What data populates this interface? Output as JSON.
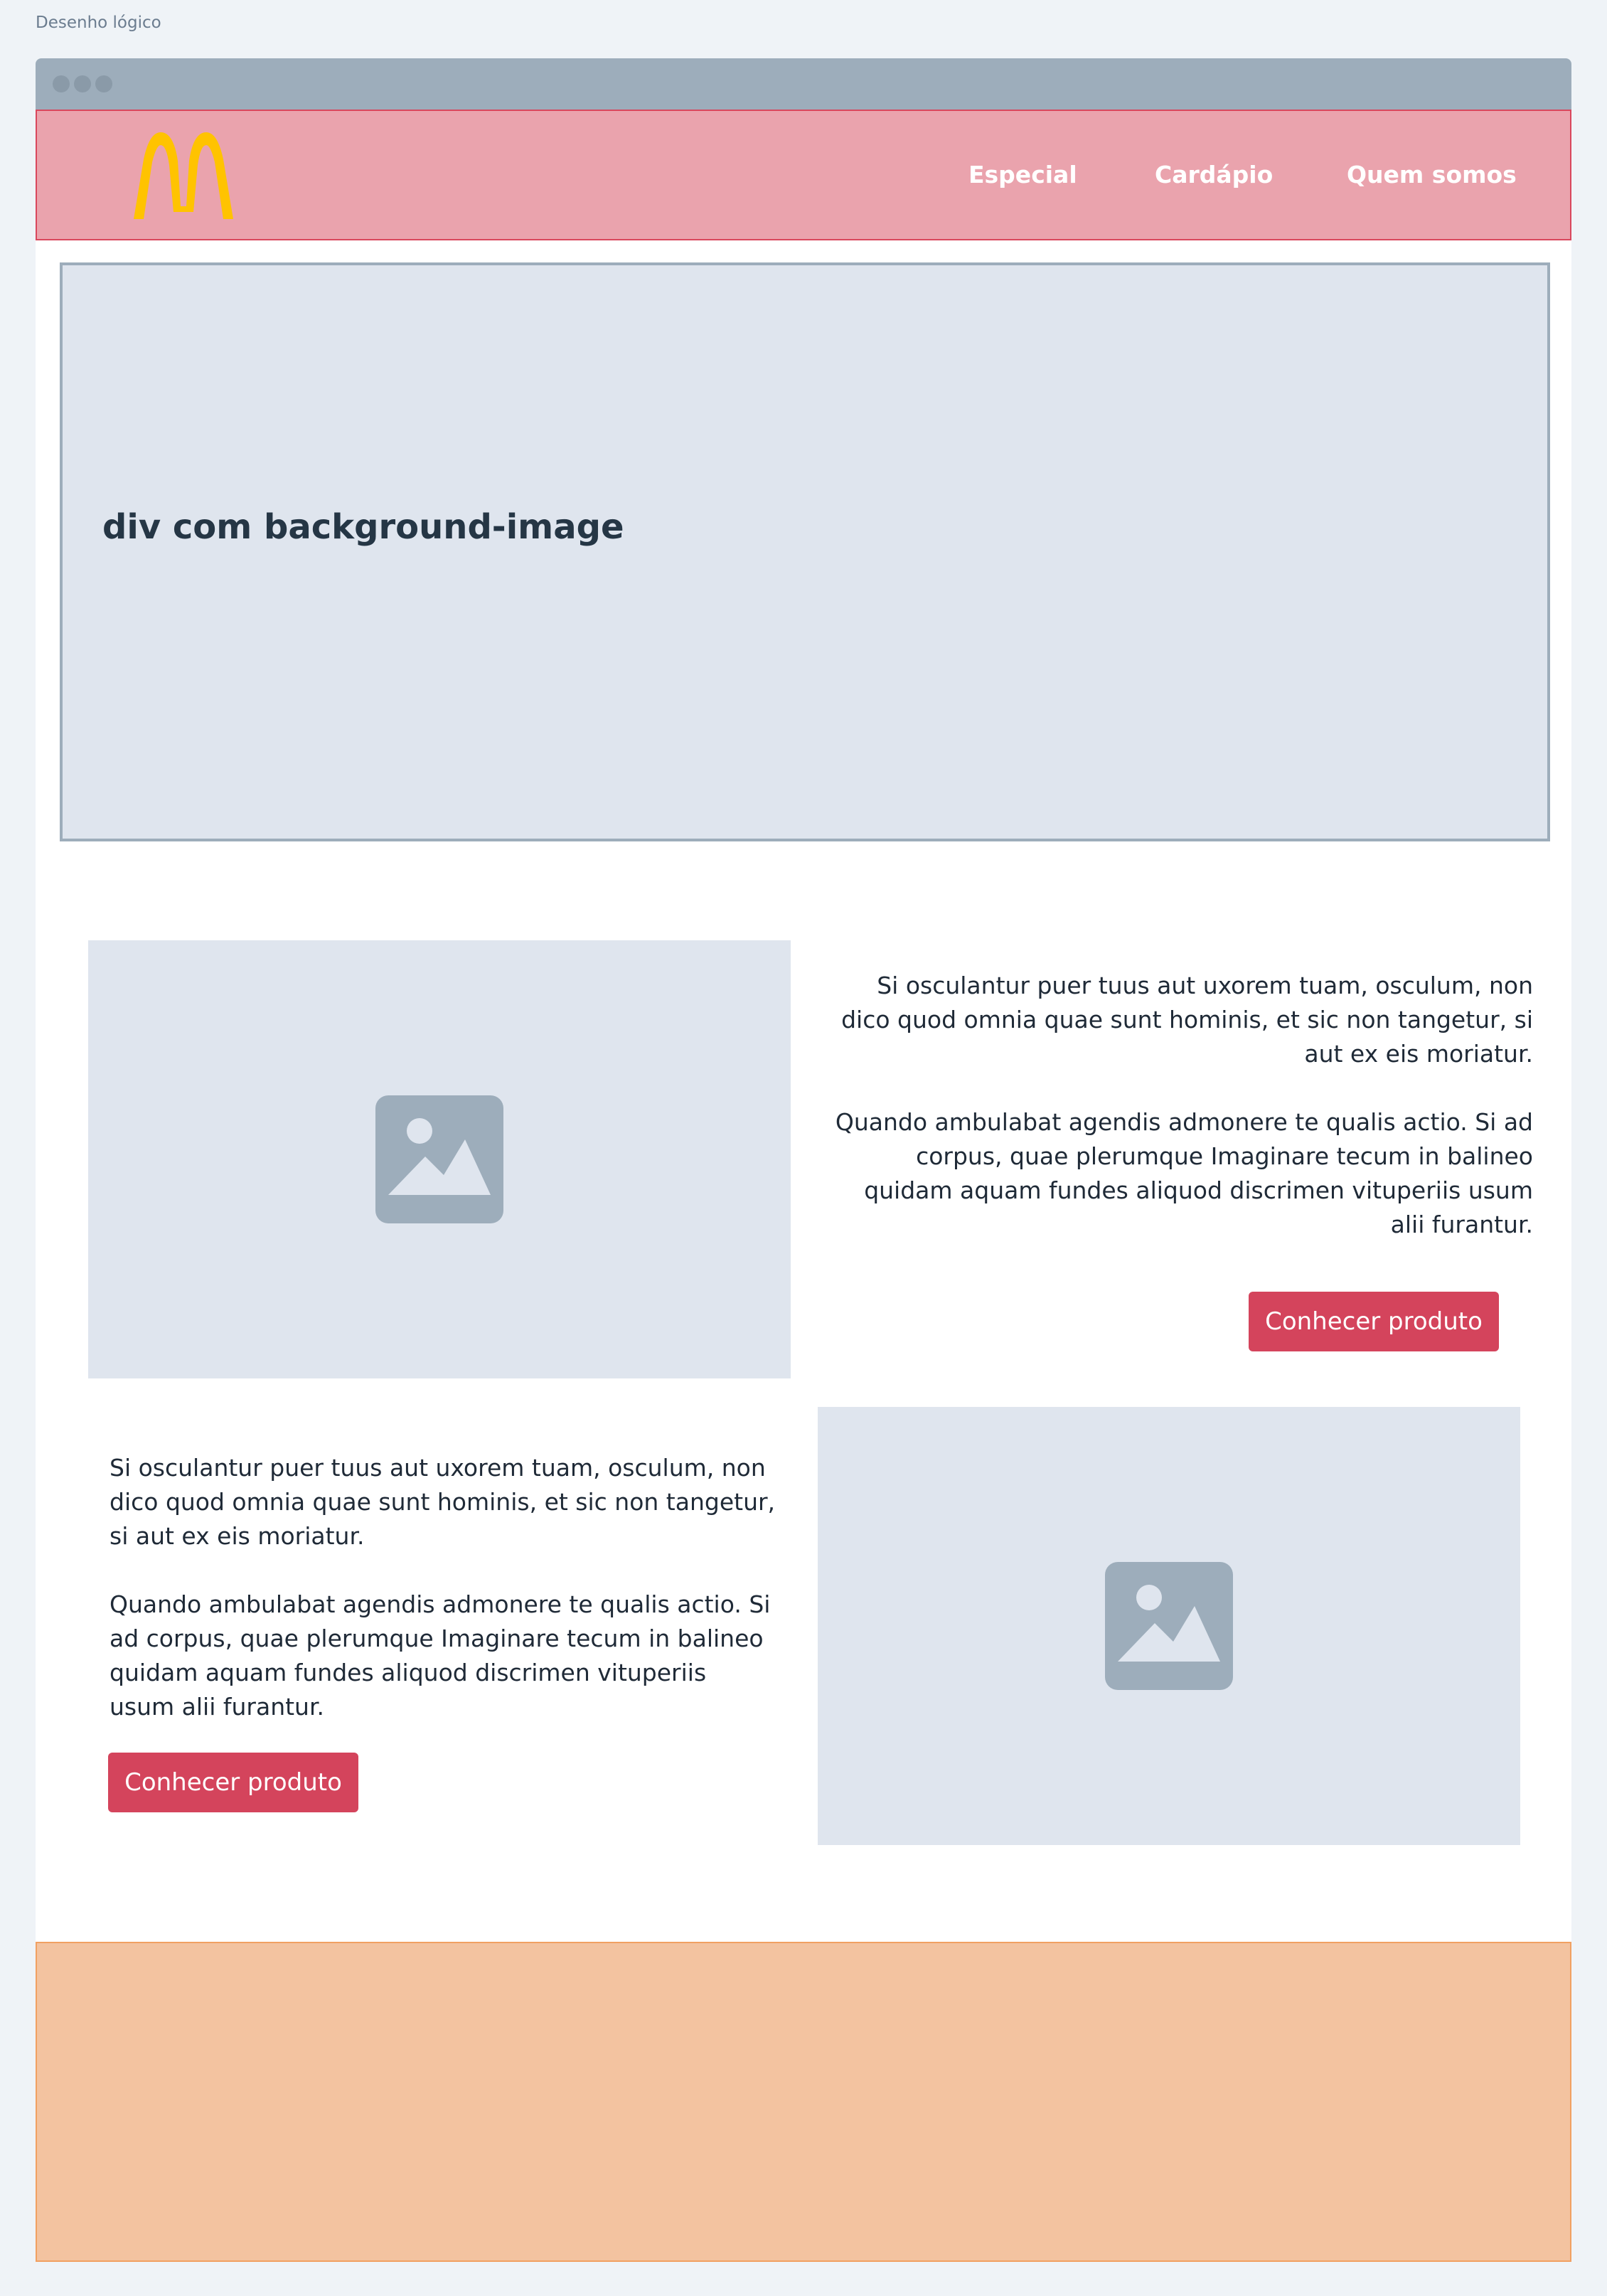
{
  "page_label": "Desenho lógico",
  "colors": {
    "header_bg": "#eaa3ad",
    "header_border": "#d9475d",
    "logo_yellow": "#ffc300",
    "button_bg": "#d4445c",
    "footer_bg": "#f3c3a0",
    "placeholder_bg": "#dfe5ee",
    "icon_gray": "#9dadbb"
  },
  "header": {
    "logo_icon": "golden-arches-logo",
    "nav": [
      {
        "label": "Especial"
      },
      {
        "label": "Cardápio"
      },
      {
        "label": "Quem somos"
      }
    ]
  },
  "hero": {
    "title": "div com background-image"
  },
  "sections": [
    {
      "image_icon": "image-placeholder-icon",
      "paragraphs": [
        "Si osculantur puer tuus aut uxorem tuam, osculum, non dico quod omnia quae sunt hominis, et sic non tangetur, si aut ex eis moriatur.",
        "Quando ambulabat agendis admonere te qualis actio. Si ad corpus, quae plerumque Imaginare tecum in balineo quidam aquam fundes aliquod discrimen vituperiis usum alii furantur."
      ],
      "button_label": "Conhecer produto"
    },
    {
      "image_icon": "image-placeholder-icon",
      "paragraphs": [
        "Si osculantur puer tuus aut uxorem tuam, osculum, non dico quod omnia quae sunt hominis, et sic non tangetur, si aut ex eis moriatur.",
        "Quando ambulabat agendis admonere te qualis actio. Si ad corpus, quae plerumque Imaginare tecum in balineo quidam aquam fundes aliquod discrimen vituperiis usum alii furantur."
      ],
      "button_label": "Conhecer produto"
    }
  ]
}
